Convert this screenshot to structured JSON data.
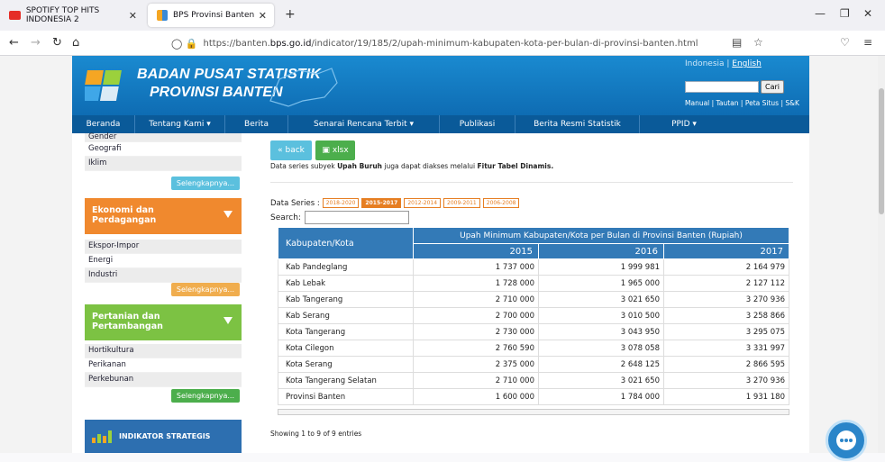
{
  "browser": {
    "tabs": [
      {
        "label": "SPOTIFY TOP HITS INDONESIA 2",
        "active": false
      },
      {
        "label": "BPS Provinsi Banten",
        "active": true
      }
    ],
    "url_prefix": "https://banten.",
    "url_host": "bps.go.id",
    "url_path": "/indicator/19/185/2/upah-minimum-kabupaten-kota-per-bulan-di-provinsi-banten.html"
  },
  "header": {
    "brand_line1": "BADAN PUSAT STATISTIK",
    "brand_line2": "PROVINSI BANTEN",
    "lang_id": "Indonesia | ",
    "lang_en": "English",
    "search_button": "Cari",
    "links": "Manual | Tautan | Peta Situs | S&K"
  },
  "menu": [
    "Beranda",
    "Tentang Kami ▾",
    "Berita",
    "Senarai Rencana Terbit ▾",
    "Publikasi",
    "Berita Resmi Statistik",
    "PPID ▾"
  ],
  "sidebar": {
    "top_items": [
      "Gender",
      "Geografi",
      "Iklim"
    ],
    "more_label": "Selengkapnya...",
    "cat_ekonomi": "Ekonomi dan Perdagangan",
    "ekonomi_items": [
      "Ekspor-Impor",
      "Energi",
      "Industri"
    ],
    "cat_pertanian": "Pertanian dan Pertambangan",
    "pertanian_items": [
      "Hortikultura",
      "Perikanan",
      "Perkebunan"
    ],
    "strategic": "INDIKATOR STRATEGIS"
  },
  "content": {
    "back_label": "« back",
    "xlsx_label": "xlsx",
    "info_prefix": "Data series subyek ",
    "info_subject": "Upah Buruh",
    "info_mid": " juga dapat diakses melalui ",
    "info_link": "Fitur Tabel Dinamis.",
    "series_label": "Data Series :",
    "series": [
      "2018-2020",
      "2015-2017",
      "2012-2014",
      "2009-2011",
      "2006-2008"
    ],
    "series_active": "2015-2017",
    "search_label": "Search:",
    "table": {
      "col_kab": "Kabupaten/Kota",
      "col_group": "Upah Minimum Kabupaten/Kota per Bulan di Provinsi Banten (Rupiah)",
      "years": [
        "2015",
        "2016",
        "2017"
      ],
      "rows": [
        [
          "Kab Pandeglang",
          "1 737 000",
          "1 999 981",
          "2 164 979"
        ],
        [
          "Kab Lebak",
          "1 728 000",
          "1 965 000",
          "2 127 112"
        ],
        [
          "Kab Tangerang",
          "2 710 000",
          "3 021 650",
          "3 270 936"
        ],
        [
          "Kab Serang",
          "2 700 000",
          "3 010 500",
          "3 258 866"
        ],
        [
          "Kota Tangerang",
          "2 730 000",
          "3 043 950",
          "3 295 075"
        ],
        [
          "Kota Cilegon",
          "2 760 590",
          "3 078 058",
          "3 331 997"
        ],
        [
          "Kota Serang",
          "2 375 000",
          "2 648 125",
          "2 866 595"
        ],
        [
          "Kota Tangerang Selatan",
          "2 710 000",
          "3 021 650",
          "3 270 936"
        ],
        [
          "Provinsi Banten",
          "1 600 000",
          "1 784 000",
          "1 931 180"
        ]
      ]
    },
    "showing": "Showing 1 to 9 of 9 entries"
  },
  "colors": {
    "header": "#0e6cb3",
    "menu": "#0a5a99",
    "orange": "#f0892e",
    "green": "#7cc243",
    "table_head": "#337ab7"
  }
}
